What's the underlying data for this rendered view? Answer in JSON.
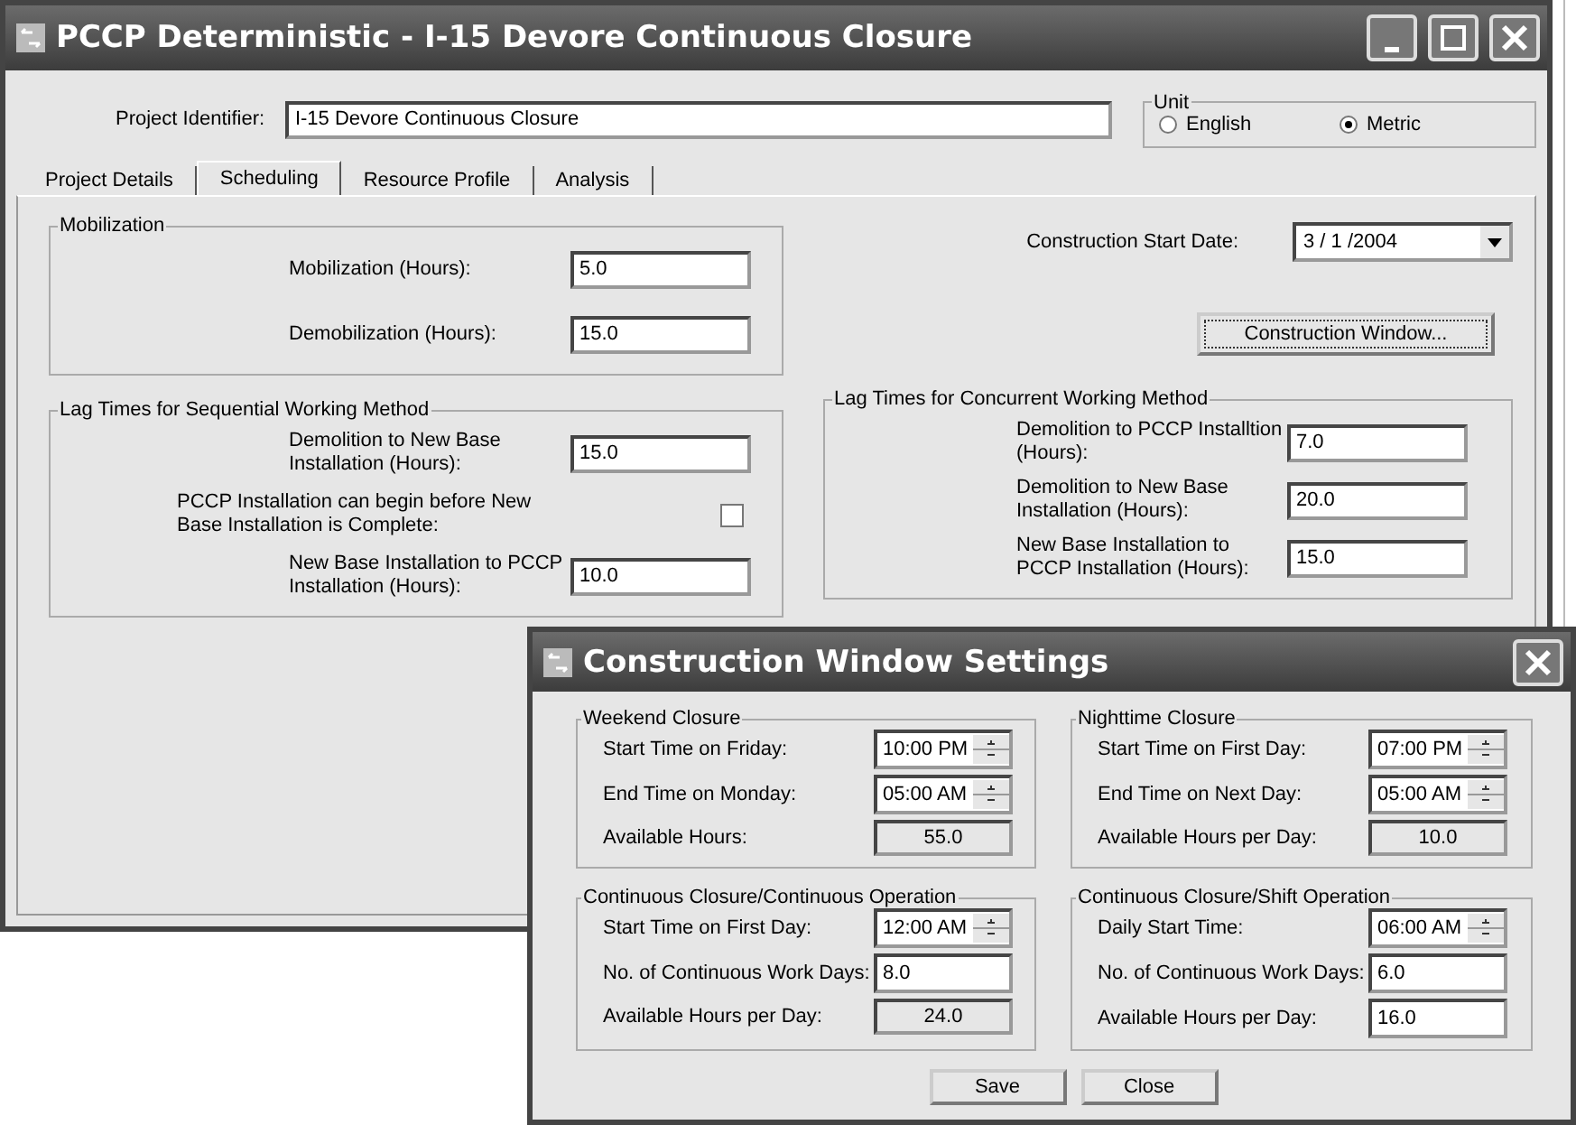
{
  "main_window": {
    "title": "PCCP Deterministic - I-15 Devore Continuous Closure",
    "project_identifier": {
      "label": "Project Identifier:",
      "value": "I-15 Devore Continuous Closure"
    },
    "unit": {
      "label": "Unit",
      "options": [
        {
          "label": "English",
          "selected": false
        },
        {
          "label": "Metric",
          "selected": true
        }
      ]
    },
    "tabs": [
      {
        "label": "Project Details",
        "selected": false
      },
      {
        "label": "Scheduling",
        "selected": true
      },
      {
        "label": "Resource Profile",
        "selected": false
      },
      {
        "label": "Analysis",
        "selected": false
      }
    ],
    "mobilization": {
      "title": "Mobilization",
      "rows": [
        {
          "kind": "field",
          "label": "Mobilization (Hours):",
          "value": "5.0"
        },
        {
          "kind": "field",
          "label": "Demobilization (Hours):",
          "value": "15.0"
        }
      ]
    },
    "sequential": {
      "title": "Lag Times for Sequential Working Method",
      "rows": [
        {
          "kind": "field",
          "label": "Demolition to New Base Installation (Hours):",
          "value": "15.0"
        },
        {
          "kind": "checkbox",
          "label": "PCCP Installation can begin before New Base Installation is Complete:",
          "checked": false
        },
        {
          "kind": "field",
          "label": "New Base Installation to PCCP Installation (Hours):",
          "value": "10.0"
        }
      ]
    },
    "start_date": {
      "label": "Construction Start Date:",
      "value": "3 / 1 /2004"
    },
    "construction_window_button": "Construction Window...",
    "concurrent": {
      "title": "Lag Times for Concurrent Working Method",
      "rows": [
        {
          "kind": "field",
          "label": "Demolition to PCCP Installtion (Hours):",
          "value": "7.0"
        },
        {
          "kind": "field",
          "label": "Demolition to New Base Installation (Hours):",
          "value": "20.0"
        },
        {
          "kind": "field",
          "label": "New Base Installation to PCCP Installation (Hours):",
          "value": "15.0"
        }
      ]
    }
  },
  "dialog": {
    "title": "Construction Window Settings",
    "groups": [
      {
        "title": "Weekend Closure",
        "fields": [
          {
            "kind": "spin",
            "label": "Start Time on Friday:",
            "value": "10:00 PM"
          },
          {
            "kind": "spin",
            "label": "End Time on Monday:",
            "value": "05:00 AM"
          },
          {
            "kind": "readonly",
            "label": "Available Hours:",
            "value": "55.0"
          }
        ]
      },
      {
        "title": "Nighttime Closure",
        "fields": [
          {
            "kind": "spin",
            "label": "Start Time on First Day:",
            "value": "07:00 PM"
          },
          {
            "kind": "spin",
            "label": "End Time on Next Day:",
            "value": "05:00 AM"
          },
          {
            "kind": "readonly",
            "label": "Available Hours per Day:",
            "value": "10.0"
          }
        ]
      },
      {
        "title": "Continuous Closure/Continuous Operation",
        "fields": [
          {
            "kind": "spin",
            "label": "Start Time on First Day:",
            "value": "12:00 AM"
          },
          {
            "kind": "text",
            "label": "No. of Continuous Work Days:",
            "value": "8.0"
          },
          {
            "kind": "readonly",
            "label": "Available Hours per Day:",
            "value": "24.0"
          }
        ]
      },
      {
        "title": "Continuous Closure/Shift Operation",
        "fields": [
          {
            "kind": "spin",
            "label": "Daily Start Time:",
            "value": "06:00 AM"
          },
          {
            "kind": "text",
            "label": "No. of Continuous Work Days:",
            "value": "6.0"
          },
          {
            "kind": "text",
            "label": "Available Hours per Day:",
            "value": "16.0"
          }
        ]
      }
    ],
    "buttons": [
      "Save",
      "Close"
    ]
  }
}
